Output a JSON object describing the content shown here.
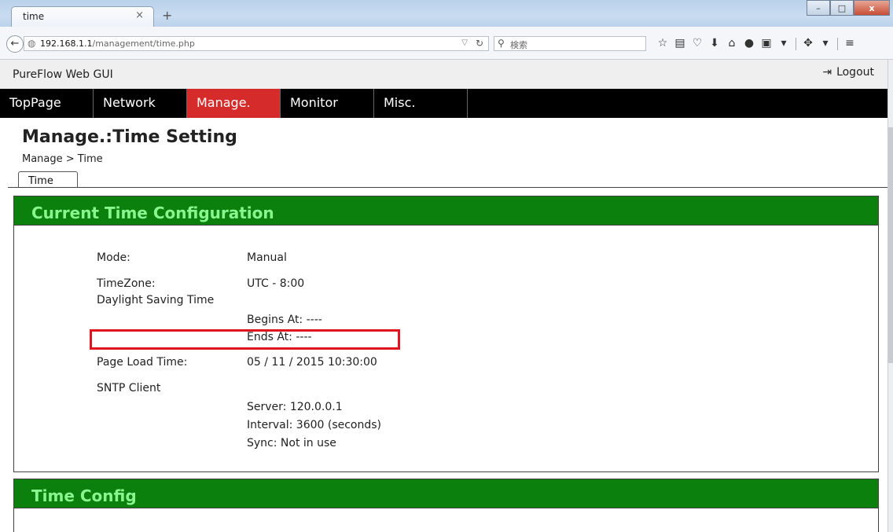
{
  "browser": {
    "tab_title": "time",
    "tab_close": "×",
    "new_tab": "+",
    "url_host": "192.168.1.1",
    "url_path": "/management/time.php",
    "search_placeholder": "検索",
    "window_buttons": [
      "–",
      "□",
      "x"
    ]
  },
  "header": {
    "title": "PureFlow Web GUI",
    "logout_label": "Logout"
  },
  "menu": {
    "items": [
      {
        "label": "TopPage",
        "active": false
      },
      {
        "label": "Network",
        "active": false
      },
      {
        "label": "Manage.",
        "active": true
      },
      {
        "label": "Monitor",
        "active": false
      },
      {
        "label": "Misc.",
        "active": false
      }
    ]
  },
  "page": {
    "heading": "Manage.:Time Setting",
    "breadcrumb": "Manage > Time",
    "tab_label": "Time"
  },
  "current_config": {
    "title": "Current Time Configuration",
    "mode_label": "Mode:",
    "mode_value": "Manual",
    "timezone_label": "TimeZone:",
    "timezone_value": "UTC - 8:00",
    "dst_label": "Daylight Saving Time",
    "dst_begins": "Begins At: ----",
    "dst_ends": "Ends At: ----",
    "load_time_label": "Page Load Time:",
    "load_time_value": "05 / 11 / 2015 10:30:00",
    "sntp_label": "SNTP Client",
    "sntp_server": "Server: 120.0.0.1",
    "sntp_interval": "Interval: 3600 (seconds)",
    "sntp_sync": "Sync: Not in use"
  },
  "time_config": {
    "title": "Time Config"
  },
  "colors": {
    "menu_active": "#d52b2b",
    "panel_header": "#0c800c",
    "panel_title": "#89f58f",
    "highlight": "#e0141e"
  }
}
